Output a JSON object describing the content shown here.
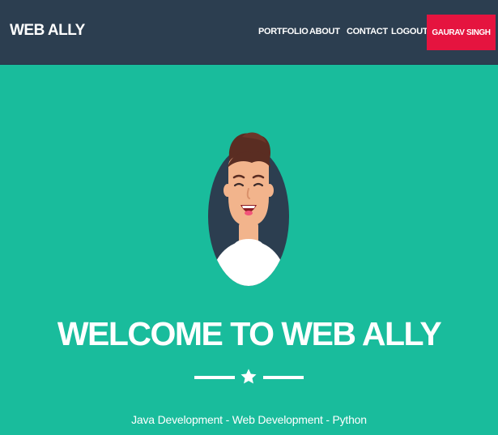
{
  "navbar": {
    "brand": "WEB ALLY",
    "items": [
      "PORTFOLIO",
      "ABOUT",
      "CONTACT",
      "LOGOUT"
    ],
    "user_button": "GAURAV SINGH"
  },
  "hero": {
    "title": "WELCOME TO WEB ALLY",
    "subtitle": "Java Development - Web Development - Python"
  },
  "colors": {
    "navbar_bg": "#2c3e50",
    "hero_bg": "#19bc9c",
    "user_button_bg": "#e5143f",
    "avatar_bg": "#2c3e50"
  },
  "icons": {
    "avatar": "person-avatar-illustration",
    "divider": "star-icon"
  }
}
